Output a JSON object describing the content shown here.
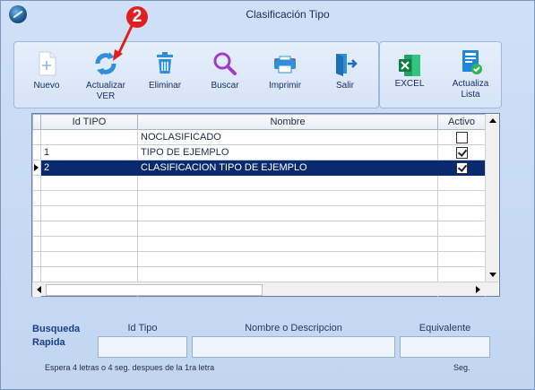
{
  "window": {
    "title": "Clasificación Tipo"
  },
  "callout": {
    "number": "2"
  },
  "toolbar": {
    "nuevo": "Nuevo",
    "actualizar_line1": "Actualizar",
    "actualizar_line2": "VER",
    "eliminar": "Eliminar",
    "buscar": "Buscar",
    "imprimir": "Imprimir",
    "salir": "Salir",
    "excel": "EXCEL",
    "actualiza_line1": "Actualiza",
    "actualiza_line2": "Lista"
  },
  "grid": {
    "columns": [
      "Id TIPO",
      "Nombre",
      "Activo"
    ],
    "rows": [
      {
        "id": "",
        "nombre": "NOCLASIFICADO",
        "activo": false
      },
      {
        "id": "1",
        "nombre": "TIPO DE EJEMPLO",
        "activo": true
      },
      {
        "id": "2",
        "nombre": "CLASIFICACION TIPO DE EJEMPLO",
        "activo": true,
        "selected": true
      }
    ]
  },
  "quick_search": {
    "title_line1": "Busqueda",
    "title_line2": "Rapida",
    "id_label": "Id Tipo",
    "name_label": "Nombre o Descripcion",
    "equiv_label": "Equivalente",
    "id_value": "",
    "name_value": "",
    "equiv_value": "",
    "hint": "Espera 4 letras o 4 seg. despues de la 1ra letra",
    "seg": "Seg."
  },
  "colors": {
    "selected_row": "#0a2a6e",
    "callout": "#e02020",
    "accent": "#1a2d6a"
  }
}
